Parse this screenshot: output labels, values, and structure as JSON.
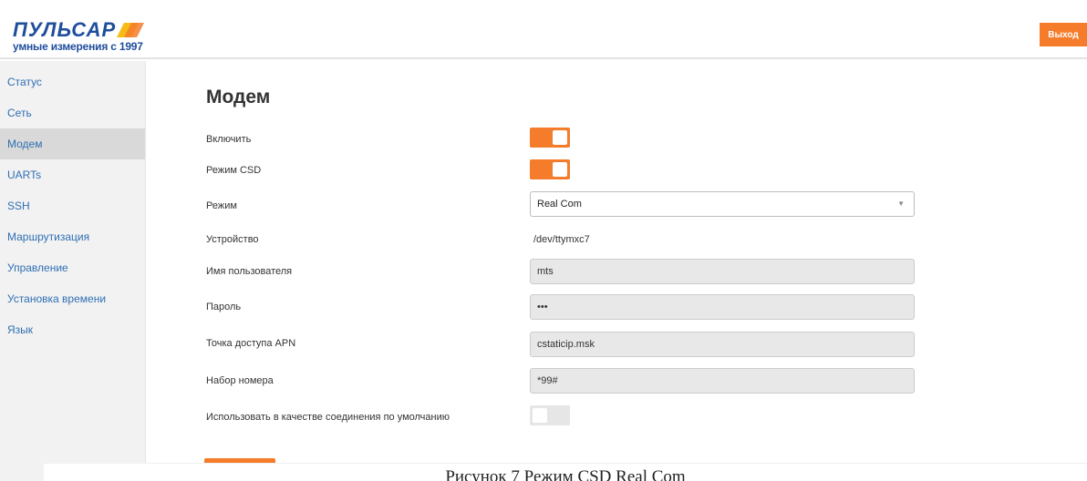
{
  "header": {
    "logo_text": "ПУЛЬСАР",
    "logo_tagline": "умные измерения с 1997",
    "logout_label": "Выход"
  },
  "sidebar": {
    "items": [
      {
        "label": "Статус"
      },
      {
        "label": "Сеть"
      },
      {
        "label": "Модем",
        "active": true
      },
      {
        "label": "UARTs"
      },
      {
        "label": "SSH"
      },
      {
        "label": "Маршрутизация"
      },
      {
        "label": "Управление"
      },
      {
        "label": "Установка времени"
      },
      {
        "label": "Язык"
      }
    ]
  },
  "main": {
    "title": "Модем",
    "fields": {
      "enable": {
        "label": "Включить",
        "on": true
      },
      "csd_mode": {
        "label": "Режим CSD",
        "on": true
      },
      "mode": {
        "label": "Режим",
        "value": "Real Com"
      },
      "device": {
        "label": "Устройство",
        "value": "/dev/ttymxc7"
      },
      "username": {
        "label": "Имя пользователя",
        "value": "mts"
      },
      "password": {
        "label": "Пароль",
        "value": "•••"
      },
      "apn": {
        "label": "Точка доступа APN",
        "value": "cstaticip.msk"
      },
      "dial": {
        "label": "Набор номера",
        "value": "*99#"
      },
      "default_connection": {
        "label": "Использовать в качестве соединения по умолчанию",
        "on": false
      }
    }
  },
  "caption": "Рисунок 7 Режим CSD Real Com",
  "colors": {
    "accent": "#f57c2a",
    "link": "#2f6fb3",
    "brand": "#1f4e9c"
  }
}
